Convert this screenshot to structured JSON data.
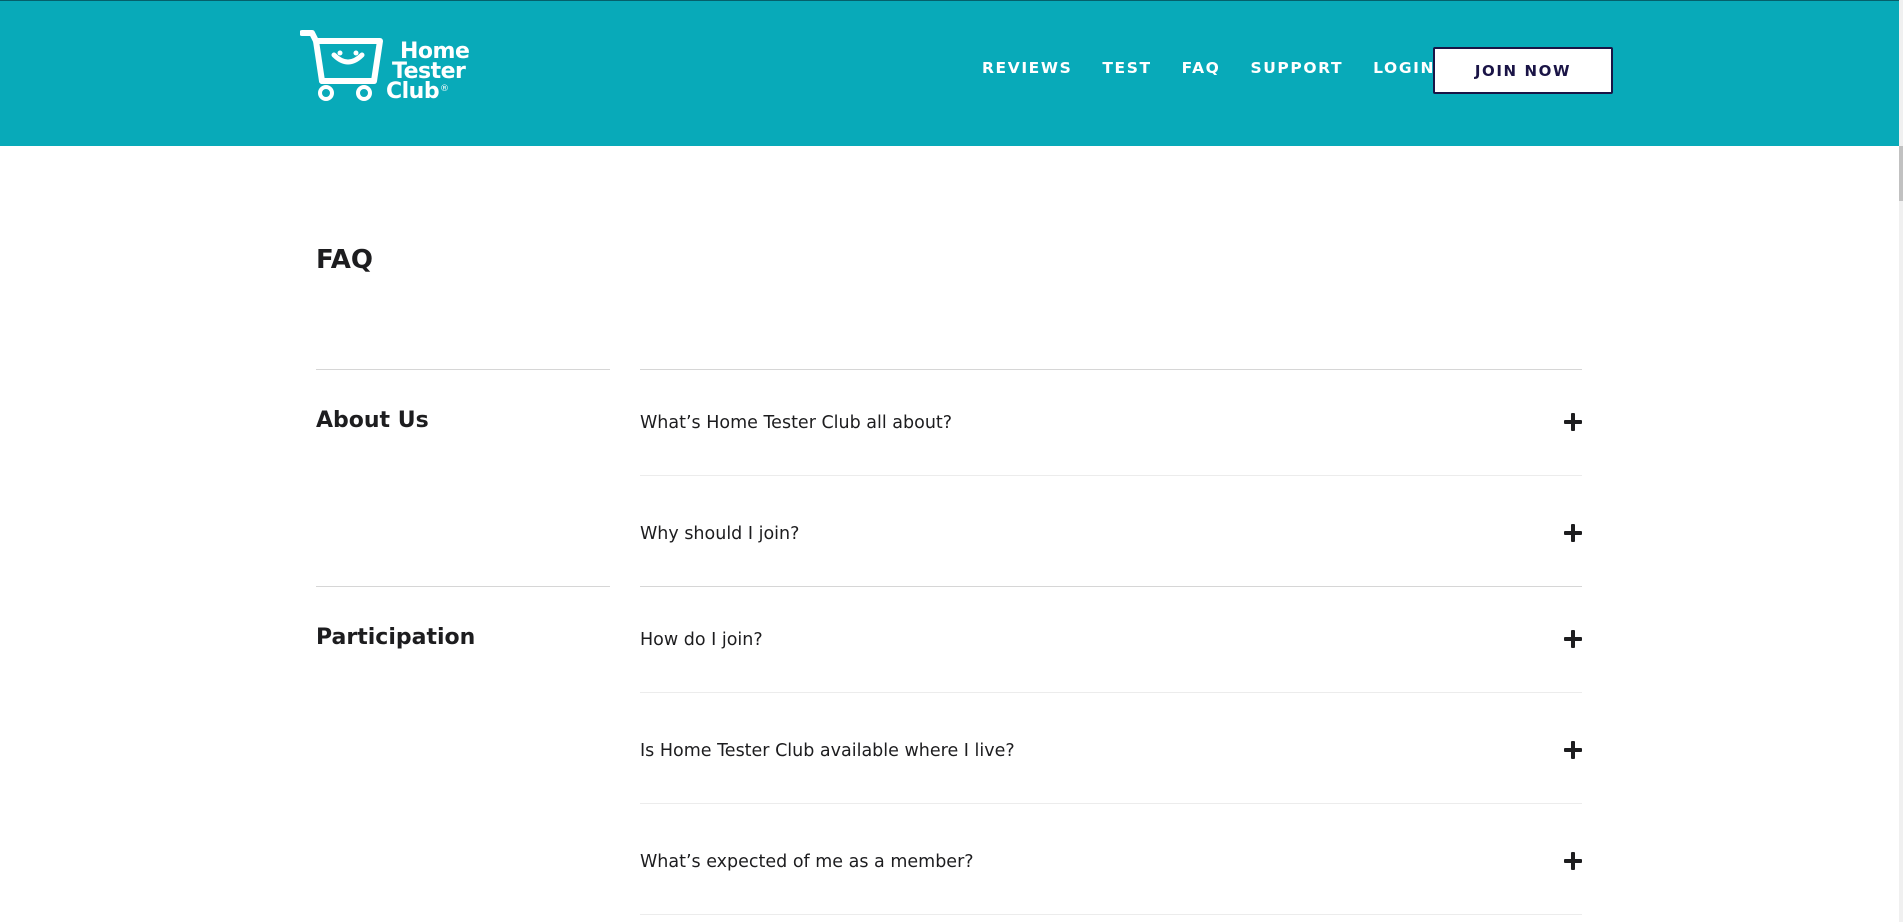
{
  "brand": {
    "line1": "Home",
    "line2": "Tester",
    "line3": "Club",
    "reg": "®",
    "color": "#08aab9"
  },
  "nav": {
    "items": [
      "REVIEWS",
      "TEST",
      "FAQ",
      "SUPPORT",
      "LOGIN"
    ],
    "cta": "JOIN NOW"
  },
  "page": {
    "title": "FAQ"
  },
  "categories": [
    {
      "title": "About Us",
      "questions": [
        "What’s Home Tester Club all about?",
        "Why should I join?"
      ]
    },
    {
      "title": "Participation",
      "questions": [
        "How do I join?",
        "Is Home Tester Club available where I live?",
        "What’s expected of me as a member?"
      ]
    }
  ],
  "icons": {
    "expand": "plus-icon",
    "cart": "shopping-cart-icon"
  }
}
